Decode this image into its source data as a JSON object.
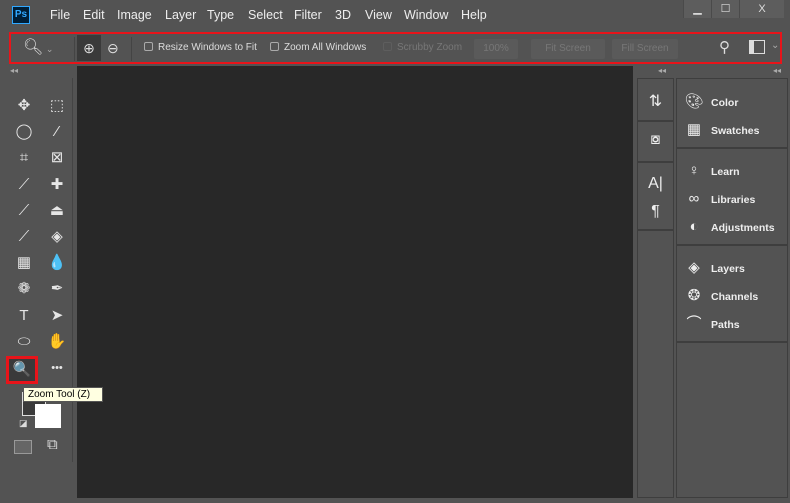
{
  "app": {
    "logo": "Ps"
  },
  "menu": [
    "File",
    "Edit",
    "Image",
    "Layer",
    "Type",
    "Select",
    "Filter",
    "3D",
    "View",
    "Window",
    "Help"
  ],
  "window_controls": {
    "minimize": "▁",
    "maximize": "☐",
    "close": "X"
  },
  "options_bar": {
    "tool_icon": "zoom-icon",
    "resize_windows": {
      "label": "Resize Windows to Fit",
      "checked": false
    },
    "zoom_all": {
      "label": "Zoom All Windows",
      "checked": false
    },
    "scrubby_zoom": {
      "label": "Scrubby Zoom",
      "checked": false,
      "disabled": true
    },
    "zoom_percent": "100%",
    "fit_screen": "Fit Screen",
    "fill_screen": "Fill Screen"
  },
  "toolbar": {
    "tools": [
      {
        "name": "move",
        "glyph": "✥"
      },
      {
        "name": "marquee",
        "glyph": "⬚"
      },
      {
        "name": "lasso",
        "glyph": "◯"
      },
      {
        "name": "magic-wand",
        "glyph": "⁄"
      },
      {
        "name": "crop",
        "glyph": "⌗"
      },
      {
        "name": "frame",
        "glyph": "⊠"
      },
      {
        "name": "eyedropper",
        "glyph": "⟋"
      },
      {
        "name": "healing",
        "glyph": "✚"
      },
      {
        "name": "brush",
        "glyph": "⟋"
      },
      {
        "name": "stamp",
        "glyph": "⏏"
      },
      {
        "name": "history-brush",
        "glyph": "⟋"
      },
      {
        "name": "eraser",
        "glyph": "◈"
      },
      {
        "name": "gradient",
        "glyph": "▦"
      },
      {
        "name": "blur",
        "glyph": "💧"
      },
      {
        "name": "dodge",
        "glyph": "❁"
      },
      {
        "name": "pen",
        "glyph": "✒"
      },
      {
        "name": "type",
        "glyph": "T"
      },
      {
        "name": "path-selection",
        "glyph": "➤"
      },
      {
        "name": "ellipse",
        "glyph": "⬭"
      },
      {
        "name": "hand",
        "glyph": "✋"
      },
      {
        "name": "zoom",
        "glyph": "🔍"
      },
      {
        "name": "more",
        "glyph": "•••"
      }
    ],
    "tooltip": "Zoom Tool (Z)",
    "colors": {
      "foreground": "#3a3a3a",
      "background": "#ffffff"
    }
  },
  "panels": {
    "narrow": [
      "history",
      "properties",
      "character",
      "paragraph"
    ],
    "groups": [
      [
        {
          "label": "Color",
          "icon": "palette-icon"
        },
        {
          "label": "Swatches",
          "icon": "grid-icon"
        }
      ],
      [
        {
          "label": "Learn",
          "icon": "lightbulb-icon"
        },
        {
          "label": "Libraries",
          "icon": "cc-libraries-icon"
        },
        {
          "label": "Adjustments",
          "icon": "adjustments-icon"
        }
      ],
      [
        {
          "label": "Layers",
          "icon": "layers-icon"
        },
        {
          "label": "Channels",
          "icon": "channels-icon"
        },
        {
          "label": "Paths",
          "icon": "paths-icon"
        }
      ]
    ]
  },
  "colors": {
    "accent_highlight": "#e8141a",
    "canvas": "#282828",
    "ui": "#535353"
  }
}
